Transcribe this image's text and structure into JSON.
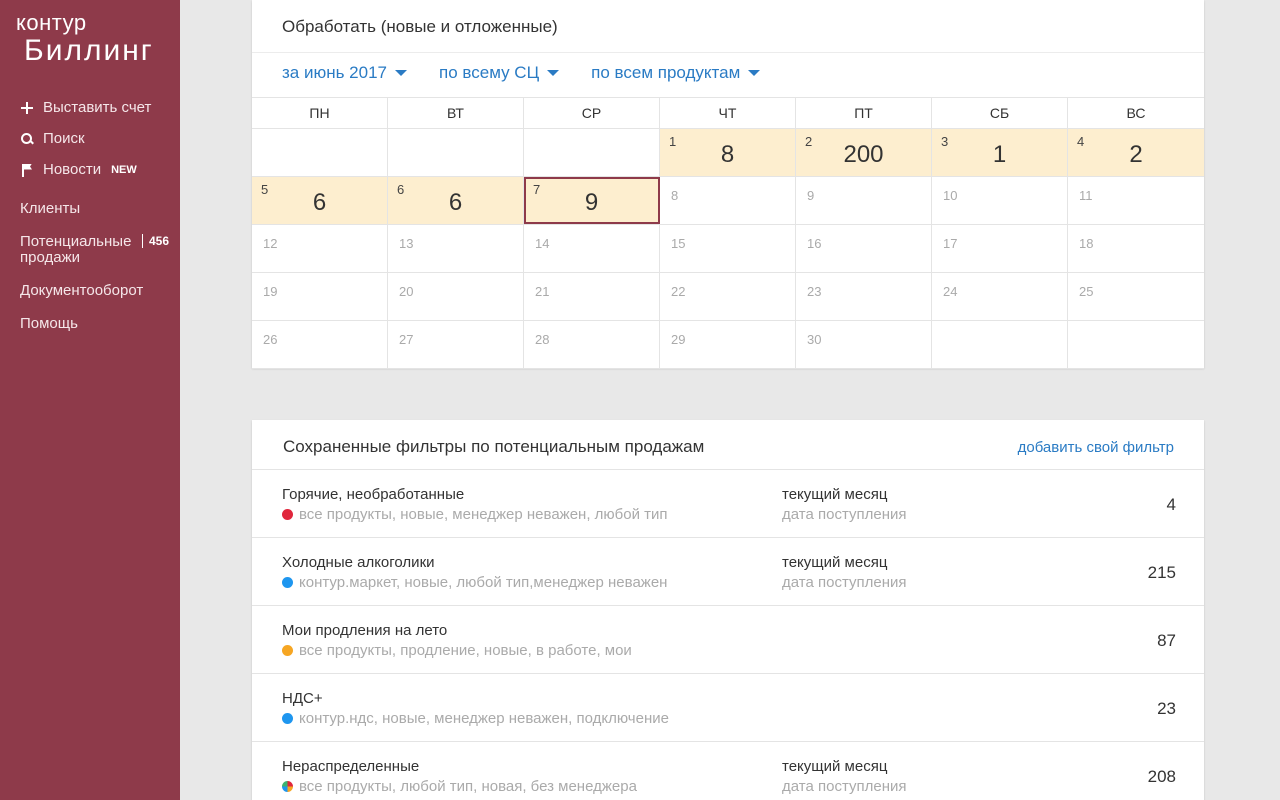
{
  "sidebar": {
    "logo_top": "контур",
    "logo_bottom": "Биллинг",
    "actions": [
      {
        "label": "Выставить счет",
        "icon": "plus-icon"
      },
      {
        "label": "Поиск",
        "icon": "search-icon"
      },
      {
        "label": "Новости",
        "icon": "flag-icon",
        "badge": "NEW"
      }
    ],
    "clients": "Клиенты",
    "potential": "Потенциальные продажи",
    "potential_count": "456",
    "docs": "Документооборот",
    "help": "Помощь",
    "bg_color": "#8e3a4a"
  },
  "calendar": {
    "title": "Обработать (новые и отложенные)",
    "filters": [
      "за июнь 2017",
      "по всему СЦ",
      "по всем продуктам"
    ],
    "weekdays": [
      "ПН",
      "ВТ",
      "СР",
      "ЧТ",
      "ПТ",
      "СБ",
      "ВС"
    ],
    "weeks": [
      [
        null,
        null,
        null,
        {
          "day": "1",
          "value": "8"
        },
        {
          "day": "2",
          "value": "200"
        },
        {
          "day": "3",
          "value": "1"
        },
        {
          "day": "4",
          "value": "2"
        }
      ],
      [
        {
          "day": "5",
          "value": "6"
        },
        {
          "day": "6",
          "value": "6"
        },
        {
          "day": "7",
          "value": "9",
          "today": true
        },
        {
          "day": "8"
        },
        {
          "day": "9"
        },
        {
          "day": "10"
        },
        {
          "day": "11"
        }
      ],
      [
        {
          "day": "12"
        },
        {
          "day": "13"
        },
        {
          "day": "14"
        },
        {
          "day": "15"
        },
        {
          "day": "16"
        },
        {
          "day": "17"
        },
        {
          "day": "18"
        }
      ],
      [
        {
          "day": "19"
        },
        {
          "day": "20"
        },
        {
          "day": "21"
        },
        {
          "day": "22"
        },
        {
          "day": "23"
        },
        {
          "day": "24"
        },
        {
          "day": "25"
        }
      ],
      [
        {
          "day": "26"
        },
        {
          "day": "27"
        },
        {
          "day": "28"
        },
        {
          "day": "29"
        },
        {
          "day": "30"
        },
        null,
        null
      ]
    ],
    "active_color": "#fdeecf",
    "link_color": "#2a7bc4"
  },
  "saved_filters": {
    "title": "Сохраненные фильтры по потенциальным продажам",
    "add_label": "добавить свой фильтр",
    "rows": [
      {
        "name": "Горячие, необработанные",
        "desc": "все продукты, новые, менеджер неважен, любой тип",
        "dot_color": "#e0263c",
        "period": "текущий месяц",
        "period_sub": "дата поступления",
        "count": "4"
      },
      {
        "name": "Холодные алкоголики",
        "desc": "контур.маркет, новые, любой тип,менеджер неважен",
        "dot_color": "#1e96ef",
        "period": "текущий месяц",
        "period_sub": "дата поступления",
        "count": "215"
      },
      {
        "name": "Мои продления на лето",
        "desc": "все продукты, продление, новые, в работе, мои",
        "dot_color": "#f6a623",
        "period": "",
        "period_sub": "",
        "count": "87"
      },
      {
        "name": "НДС+",
        "desc": "контур.ндс, новые, менеджер неважен, подключение",
        "dot_color": "#1e96ef",
        "period": "",
        "period_sub": "",
        "count": "23"
      },
      {
        "name": "Нераспределенные",
        "desc": "все продукты, любой тип, новая, без менеджера",
        "dot_color": "multi",
        "period": "текущий месяц",
        "period_sub": "дата поступления",
        "count": "208"
      }
    ]
  }
}
